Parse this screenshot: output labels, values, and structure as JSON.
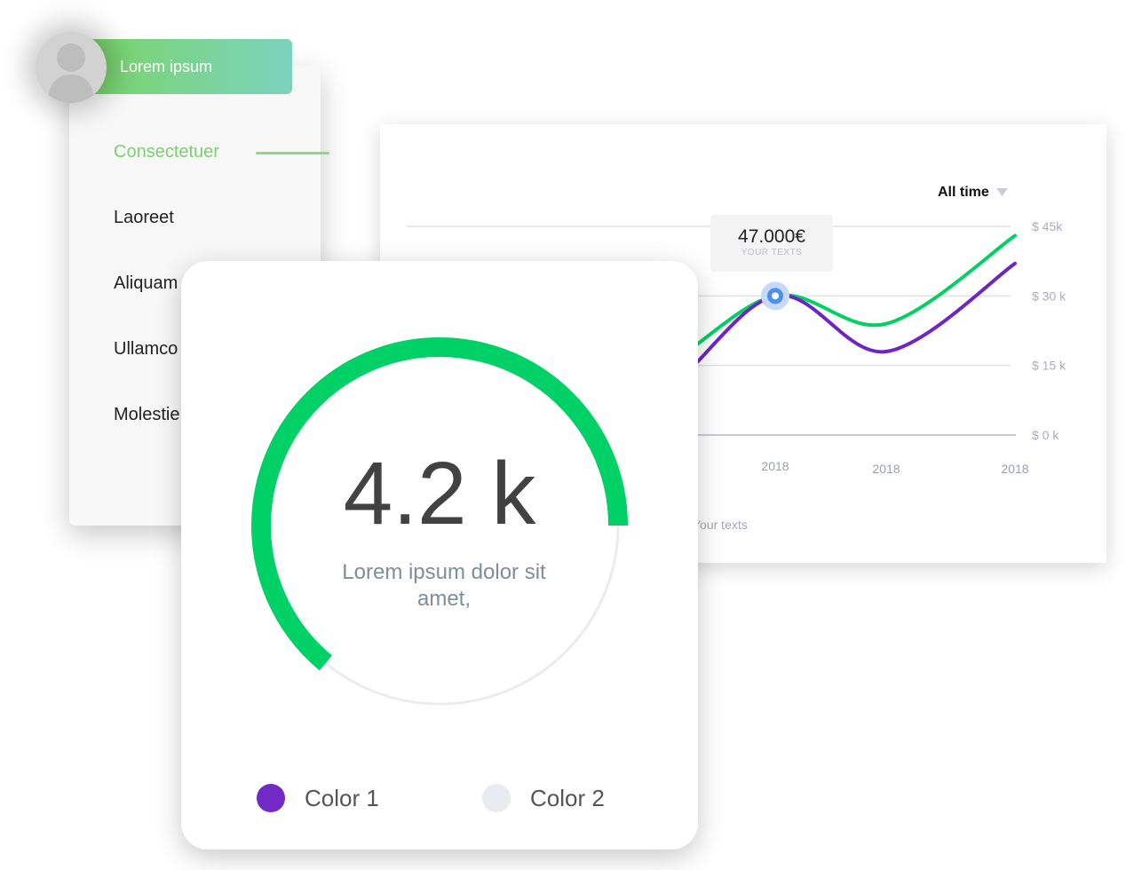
{
  "user": {
    "name": "Lorem ipsum"
  },
  "menu": {
    "items": [
      {
        "label": "Consectetuer",
        "active": true
      },
      {
        "label": "Laoreet",
        "active": false
      },
      {
        "label": "Aliquam",
        "active": false
      },
      {
        "label": "Ullamco",
        "active": false
      },
      {
        "label": "Molestie",
        "active": false
      }
    ]
  },
  "chart": {
    "period_label": "All time",
    "footer_text": "Your texts",
    "tooltip": {
      "value": "47.000€",
      "label": "YOUR TEXTS"
    }
  },
  "chart_data": {
    "type": "line",
    "x": [
      "2018",
      "2018",
      "2018",
      "2018",
      "2018"
    ],
    "y_ticks": [
      "$ 0 k",
      "$ 15 k",
      "$ 30 k",
      "$ 45k"
    ],
    "ylim": [
      0,
      45
    ],
    "grid": true,
    "series": [
      {
        "color": "#00d162",
        "values": [
          10,
          14,
          30,
          24,
          43
        ]
      },
      {
        "color": "#6f25c4",
        "values": [
          4,
          8,
          30,
          18,
          37
        ]
      }
    ],
    "highlight": {
      "index": 2,
      "value": 30
    }
  },
  "gauge": {
    "value_text": "4.2 k",
    "caption": "Lorem ipsum dolor sit amet,",
    "progress": 0.64,
    "colors": {
      "progress": "#00d166",
      "track": "#ececec"
    },
    "legend": [
      {
        "label": "Color 1",
        "color": "#7229c5"
      },
      {
        "label": "Color 2",
        "color": "#e8ebef"
      }
    ]
  }
}
